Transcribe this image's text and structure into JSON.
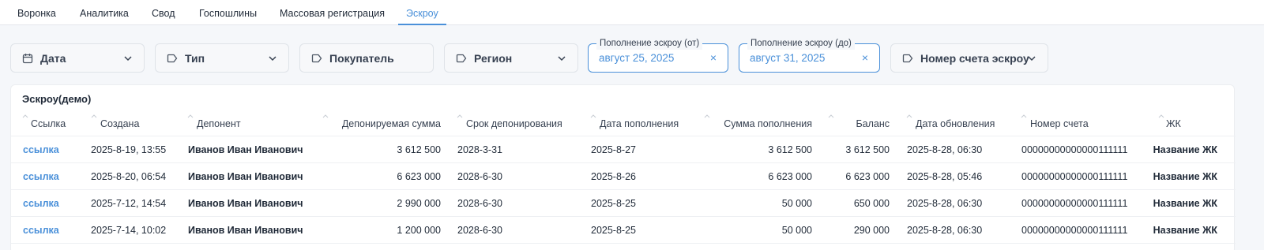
{
  "tabs": [
    {
      "label": "Воронка"
    },
    {
      "label": "Аналитика"
    },
    {
      "label": "Свод"
    },
    {
      "label": "Госпошлины"
    },
    {
      "label": "Массовая регистрация"
    },
    {
      "label": "Эскроу"
    }
  ],
  "active_tab": "Эскроу",
  "accent_color": "#4a90d9",
  "filters": {
    "date": {
      "label": "Дата",
      "icon": "calendar-icon"
    },
    "type": {
      "label": "Тип",
      "icon": "tag-icon"
    },
    "buyer": {
      "label": "Покупатель",
      "icon": "tag-icon"
    },
    "region": {
      "label": "Регион",
      "icon": "tag-icon"
    },
    "topup_from": {
      "legend": "Пополнение эскроу (от)",
      "value": "август 25, 2025",
      "clear": "×"
    },
    "topup_to": {
      "legend": "Пополнение эскроу (до)",
      "value": "август 31, 2025",
      "clear": "×"
    },
    "account": {
      "label": "Номер счета эскроу",
      "icon": "tag-icon"
    }
  },
  "table": {
    "title": "Эскроу(демо)",
    "columns": [
      "Ссылка",
      "Создана",
      "Депонент",
      "Депонируемая сумма",
      "Срок депонирования",
      "Дата пополнения",
      "Сумма пополнения",
      "Баланс",
      "Дата обновления",
      "Номер счета",
      "ЖК"
    ],
    "rows": [
      [
        "ссылка",
        "2025-8-19, 13:55",
        "Иванов Иван Иванович",
        "3 612 500",
        "2028-3-31",
        "2025-8-27",
        "3 612 500",
        "3 612 500",
        "2025-8-28, 06:30",
        "00000000000000111111",
        "Название ЖК"
      ],
      [
        "ссылка",
        "2025-8-20, 06:54",
        "Иванов Иван Иванович",
        "6 623 000",
        "2028-6-30",
        "2025-8-26",
        "6 623 000",
        "6 623 000",
        "2025-8-28, 05:46",
        "00000000000000111111",
        "Название ЖК"
      ],
      [
        "ссылка",
        "2025-7-12, 14:54",
        "Иванов Иван Иванович",
        "2 990 000",
        "2028-6-30",
        "2025-8-25",
        "50 000",
        "650 000",
        "2025-8-28, 06:30",
        "00000000000000111111",
        "Название ЖК"
      ],
      [
        "ссылка",
        "2025-7-14, 10:02",
        "Иванов Иван Иванович",
        "1 200 000",
        "2028-6-30",
        "2025-8-25",
        "50 000",
        "290 000",
        "2025-8-28, 06:30",
        "00000000000000111111",
        "Название ЖК"
      ]
    ]
  }
}
